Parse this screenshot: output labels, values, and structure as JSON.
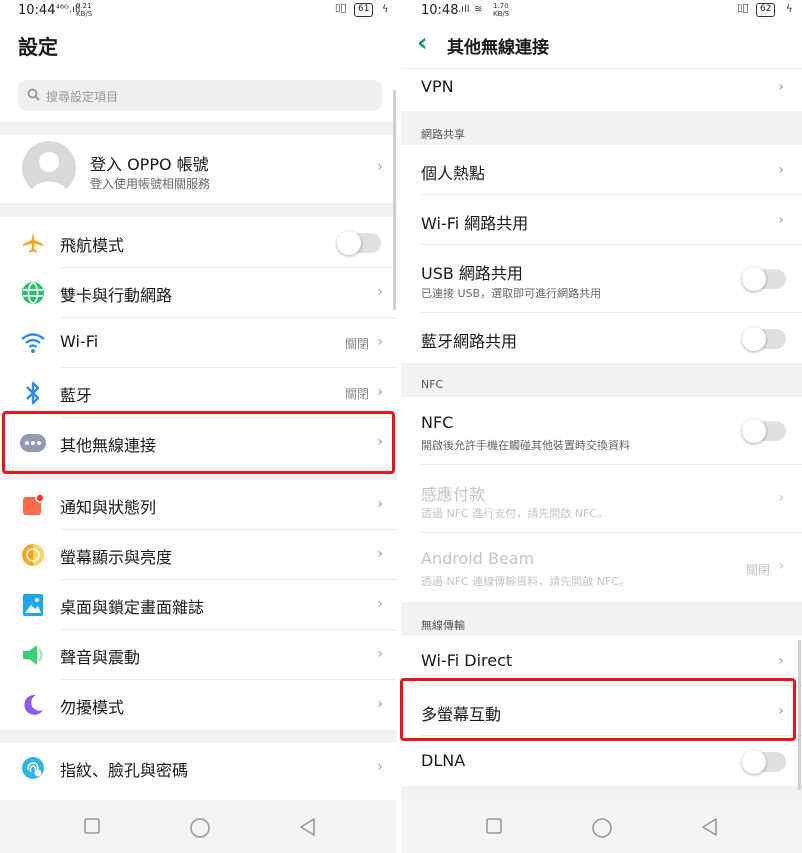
{
  "left": {
    "status": {
      "time": "10:44",
      "net_top": "0.21",
      "net_bottom": "KB/S",
      "signal": "⁴⁶ᴳ.ıll",
      "battery": "61"
    },
    "title": "設定",
    "search": {
      "placeholder": "搜尋設定項目"
    },
    "account": {
      "title": "登入 OPPO 帳號",
      "subtitle": "登入使用帳號相關服務"
    },
    "items": [
      {
        "label": "飛航模式",
        "icon": "airplane-icon",
        "control": "toggle"
      },
      {
        "label": "雙卡與行動網路",
        "icon": "globe-icon",
        "control": "chevron"
      },
      {
        "label": "Wi-Fi",
        "icon": "wifi-icon",
        "value": "關閉",
        "control": "chevron"
      },
      {
        "label": "藍牙",
        "icon": "bluetooth-icon",
        "value": "關閉",
        "control": "chevron"
      },
      {
        "label": "其他無線連接",
        "icon": "more-dots-icon",
        "control": "chevron"
      },
      {
        "label": "通知與狀態列",
        "icon": "notification-icon",
        "control": "chevron"
      },
      {
        "label": "螢幕顯示與亮度",
        "icon": "brightness-icon",
        "control": "chevron"
      },
      {
        "label": "桌面與鎖定畫面雜誌",
        "icon": "wallpaper-icon",
        "control": "chevron"
      },
      {
        "label": "聲音與震動",
        "icon": "speaker-icon",
        "control": "chevron"
      },
      {
        "label": "勿擾模式",
        "icon": "moon-icon",
        "control": "chevron"
      },
      {
        "label": "指紋、臉孔與密碼",
        "icon": "fingerprint-icon",
        "control": "chevron"
      }
    ]
  },
  "right": {
    "status": {
      "time": "10:48",
      "net_top": "1.70",
      "net_bottom": "KB/S",
      "signal": ".ıll",
      "battery": "62"
    },
    "title": "其他無線連接",
    "vpn": "VPN",
    "sections": {
      "tethering": "網路共享",
      "nfc": "NFC",
      "wireless": "無線傳輸"
    },
    "items": {
      "hotspot": "個人熱點",
      "wifi_share": "Wi-Fi 網路共用",
      "usb_share": "USB 網路共用",
      "usb_share_sub": "已連接 USB，選取即可進行網路共用",
      "bt_share": "藍牙網路共用",
      "nfc": "NFC",
      "nfc_sub": "開啟後允許手機在觸碰其他裝置時交換資料",
      "tap_pay": "感應付款",
      "tap_pay_sub": "透過 NFC 進行支付，請先開啟 NFC。",
      "beam": "Android Beam",
      "beam_sub": "透過 NFC 連線傳輸資料，請先開啟 NFC。",
      "beam_value": "關閉",
      "wifi_direct": "Wi-Fi Direct",
      "multiscreen": "多螢幕互動",
      "dlna": "DLNA"
    }
  },
  "chevron": "›",
  "colors": {
    "accent": "#1a9e5c",
    "highlight": "#e8141c"
  }
}
